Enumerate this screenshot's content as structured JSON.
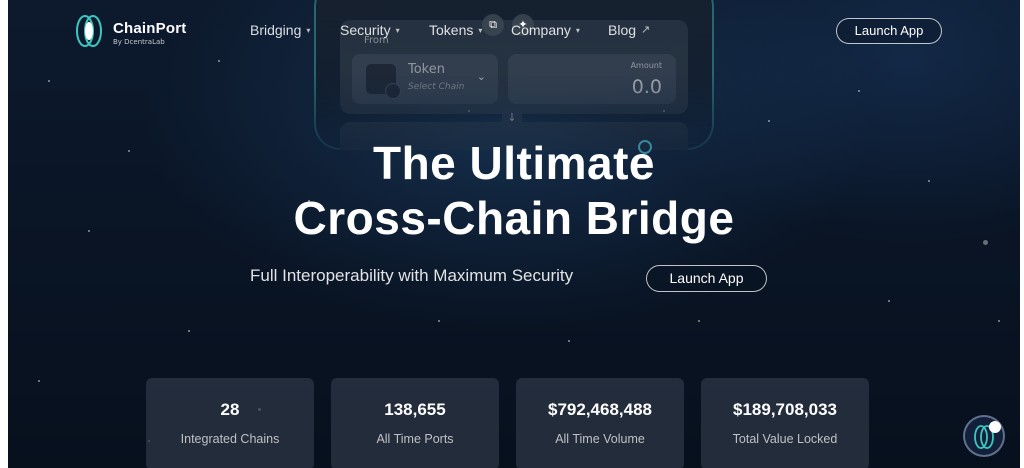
{
  "brand": {
    "name": "ChainPort",
    "tagline": "By DcentraLab"
  },
  "nav": {
    "items": [
      {
        "label": "Bridging",
        "has_dropdown": true
      },
      {
        "label": "Security",
        "has_dropdown": true
      },
      {
        "label": "Tokens",
        "has_dropdown": true
      },
      {
        "label": "Company",
        "has_dropdown": true
      },
      {
        "label": "Blog",
        "external": true
      }
    ],
    "launch_label": "Launch App"
  },
  "widget": {
    "from_label": "From",
    "token_label": "Token",
    "token_sub": "Select Chain",
    "amount_label": "Amount",
    "amount_value": "0.0"
  },
  "hero": {
    "title_line1": "The Ultimate",
    "title_line2": "Cross-Chain Bridge",
    "subtitle": "Full Interoperability with Maximum Security",
    "launch_label": "Launch App"
  },
  "stats": [
    {
      "value": "28",
      "label": "Integrated Chains"
    },
    {
      "value": "138,655",
      "label": "All Time Ports"
    },
    {
      "value": "$792,468,488",
      "label": "All Time Volume"
    },
    {
      "value": "$189,708,033",
      "label": "Total Value Locked"
    }
  ],
  "colors": {
    "accent": "#3cbebe",
    "background": "#0a1526",
    "card": "#2e3846"
  }
}
